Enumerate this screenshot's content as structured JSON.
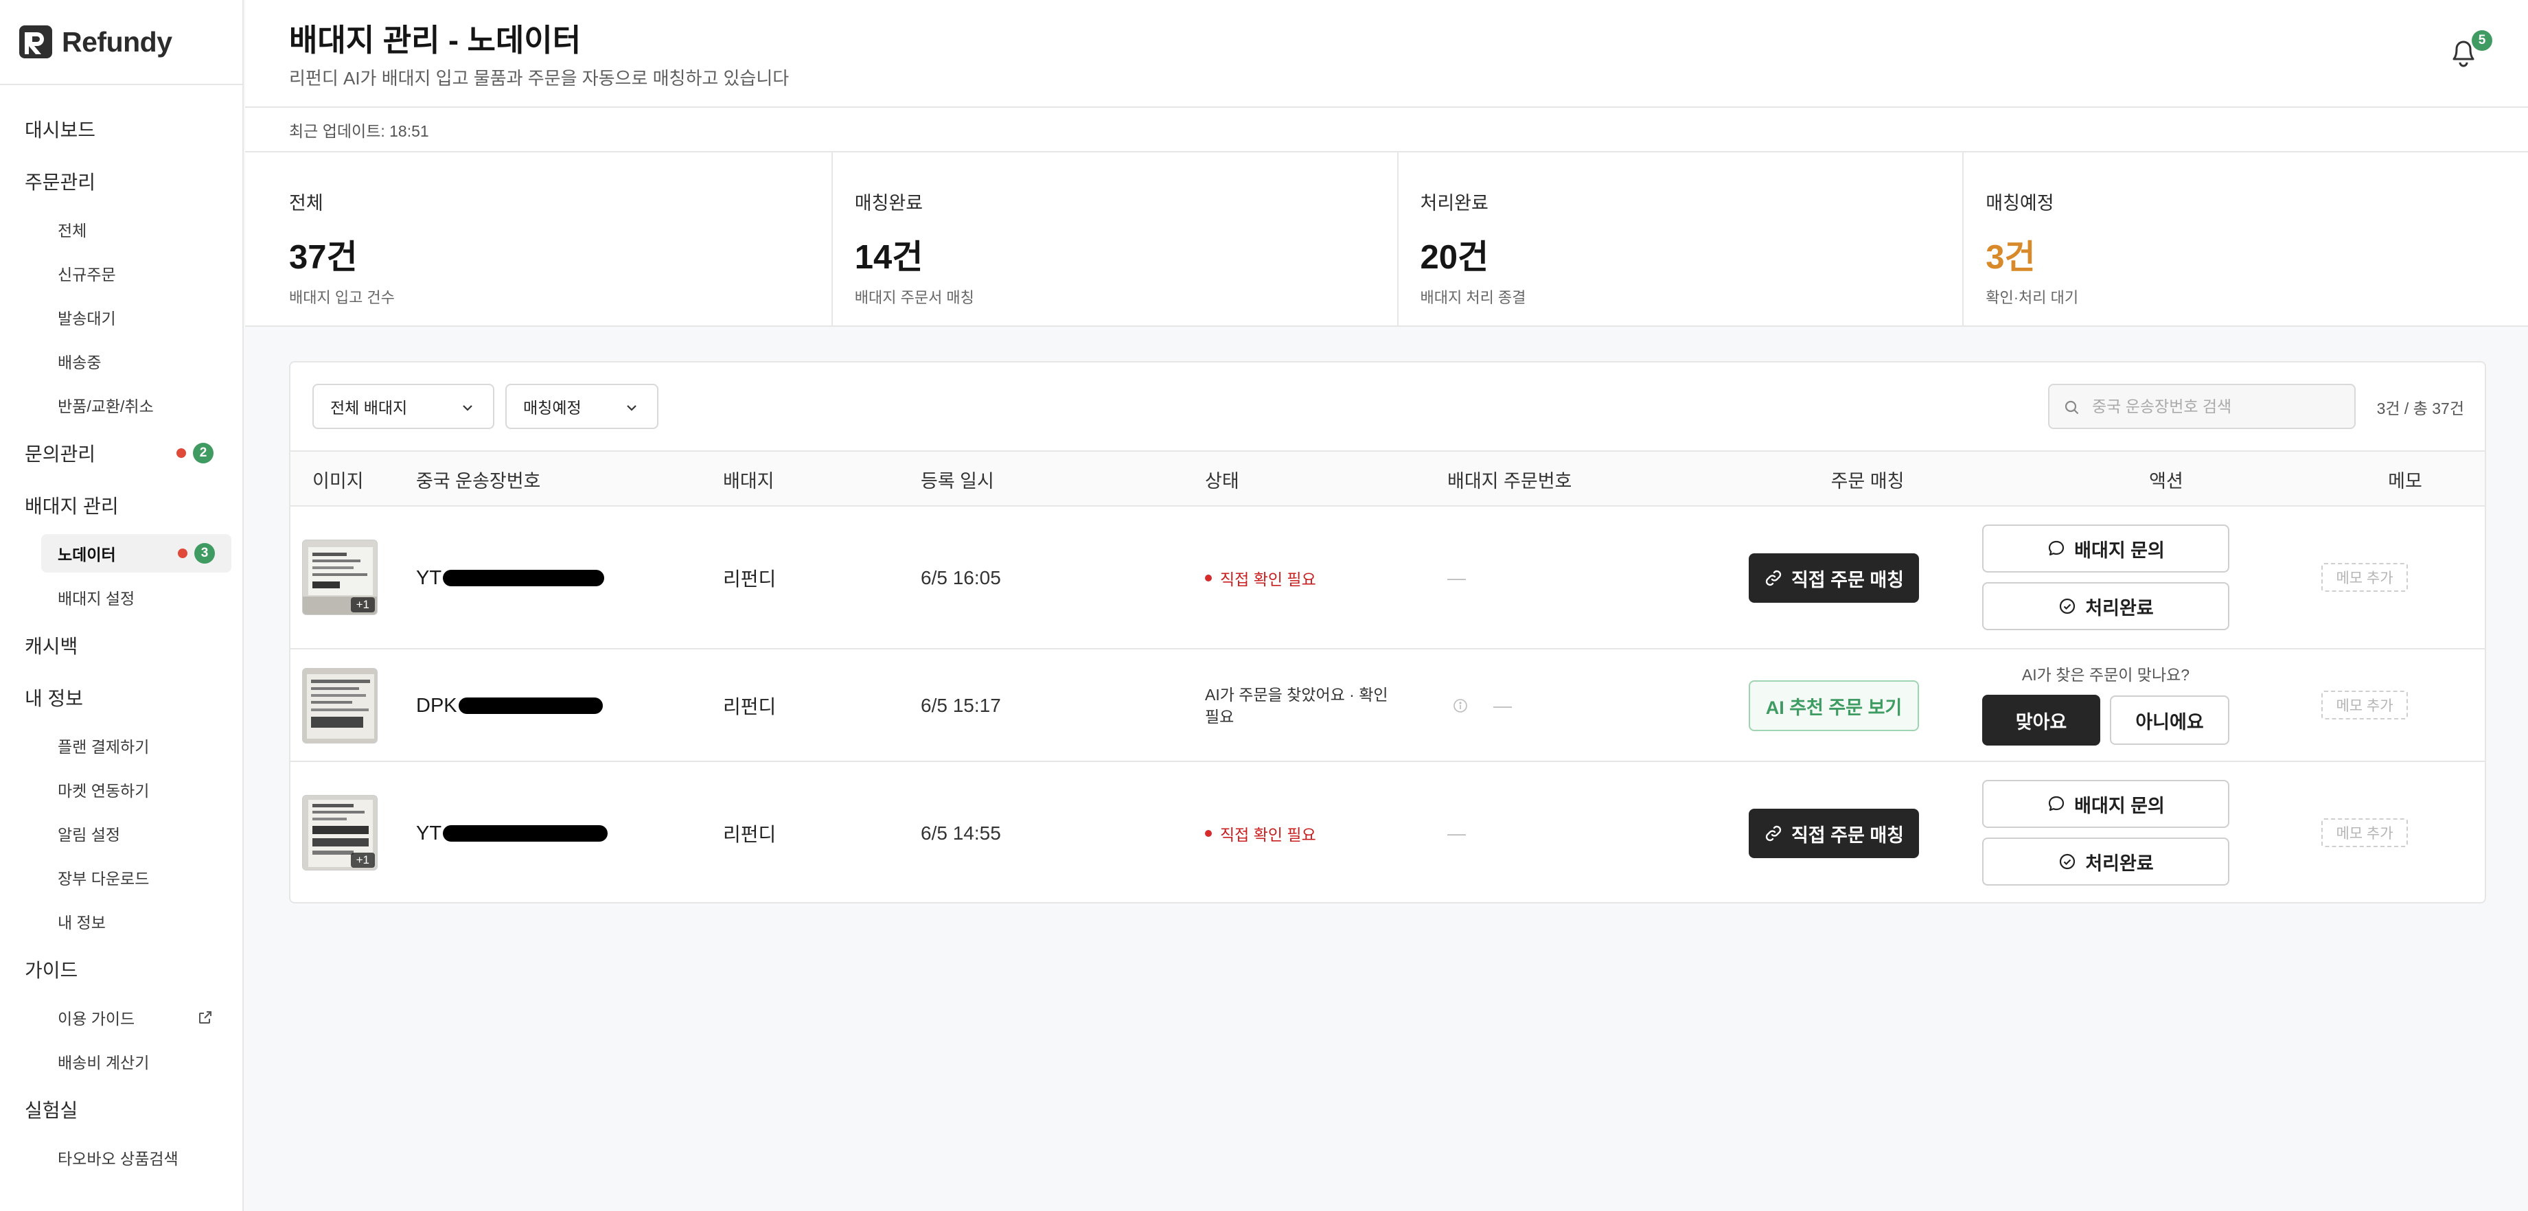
{
  "brand": {
    "name": "Refundy"
  },
  "sidebar": {
    "groups": [
      {
        "label": "대시보드",
        "items": []
      },
      {
        "label": "주문관리",
        "items": [
          "전체",
          "신규주문",
          "발송대기",
          "배송중",
          "반품/교환/취소"
        ]
      },
      {
        "label": "문의관리",
        "badge": "2",
        "items": []
      },
      {
        "label": "배대지 관리",
        "items": []
      },
      {
        "label": "캐시백",
        "items": []
      },
      {
        "label": "내 정보",
        "items": []
      },
      {
        "label": "가이드",
        "items": []
      },
      {
        "label": "실험실",
        "items": []
      }
    ],
    "labels": {
      "dashboard": "대시보드",
      "orders": "주문관리",
      "orders_all": "전체",
      "orders_new": "신규주문",
      "orders_ready": "발송대기",
      "orders_shipping": "배송중",
      "orders_returns": "반품/교환/취소",
      "inquiries": "문의관리",
      "inquiries_badge": "2",
      "forwarder": "배대지 관리",
      "forwarder_nodata": "노데이터",
      "forwarder_nodata_badge": "3",
      "forwarder_settings": "배대지 설정",
      "cashback": "캐시백",
      "myinfo": "내 정보",
      "plan_payment": "플랜 결제하기",
      "market_link": "마켓 연동하기",
      "notify_settings": "알림 설정",
      "ledger_download": "장부 다운로드",
      "my_profile": "내 정보",
      "guide": "가이드",
      "usage_guide": "이용 가이드",
      "shipping_calc": "배송비 계산기",
      "lab": "실험실",
      "taobao_search": "타오바오 상품검색"
    }
  },
  "header": {
    "title": "배대지 관리 - 노데이터",
    "subtitle": "리펀디 AI가 배대지 입고 물품과 주문을 자동으로 매칭하고 있습니다",
    "notification_count": "5"
  },
  "updated": "최근 업데이트: 18:51",
  "stats": [
    {
      "label": "전체",
      "value": "37건",
      "desc": "배대지 입고 건수",
      "accent": ""
    },
    {
      "label": "매칭완료",
      "value": "14건",
      "desc": "배대지 주문서 매칭",
      "accent": ""
    },
    {
      "label": "처리완료",
      "value": "20건",
      "desc": "배대지 처리 종결",
      "accent": ""
    },
    {
      "label": "매칭예정",
      "value": "3건",
      "desc": "확인·처리 대기",
      "accent": "#d88a2a"
    }
  ],
  "filters": {
    "forwarder_select": "전체 배대지",
    "status_select": "매칭예정",
    "search_placeholder": "중국 운송장번호 검색",
    "result_count": "3건 / 총 37건"
  },
  "table": {
    "columns": [
      "이미지",
      "중국 운송장번호",
      "배대지",
      "등록 일시",
      "상태",
      "배대지 주문번호",
      "주문 매칭",
      "액션",
      "메모"
    ],
    "rows": [
      {
        "image_badge": "+1",
        "tracking_prefix": "YT",
        "forwarder": "리펀디",
        "registered": "6/5 16:05",
        "status": "직접 확인 필요",
        "order_no": "—",
        "match_button": "직접 주문 매칭",
        "action_inquiry": "배대지 문의",
        "action_done": "처리완료",
        "memo": "메모 추가"
      },
      {
        "image_badge": "",
        "tracking_prefix": "DPK",
        "forwarder": "리펀디",
        "registered": "6/5 15:17",
        "status": "AI가 주문을 찾았어요 · 확인 필요",
        "order_no": "—",
        "match_button": "AI 추천 주문 보기",
        "ai_question": "AI가 찾은 주문이 맞나요?",
        "action_yes": "맞아요",
        "action_no": "아니에요",
        "memo": "메모 추가"
      },
      {
        "image_badge": "+1",
        "tracking_prefix": "YT",
        "forwarder": "리펀디",
        "registered": "6/5 14:55",
        "status": "직접 확인 필요",
        "order_no": "—",
        "match_button": "직접 주문 매칭",
        "action_inquiry": "배대지 문의",
        "action_done": "처리완료",
        "memo": "메모 추가"
      }
    ]
  },
  "colors": {
    "accent_green": "#3f9b62",
    "warn_red": "#c81e1e",
    "pending_orange": "#d88a2a",
    "dark_button": "#262626"
  }
}
